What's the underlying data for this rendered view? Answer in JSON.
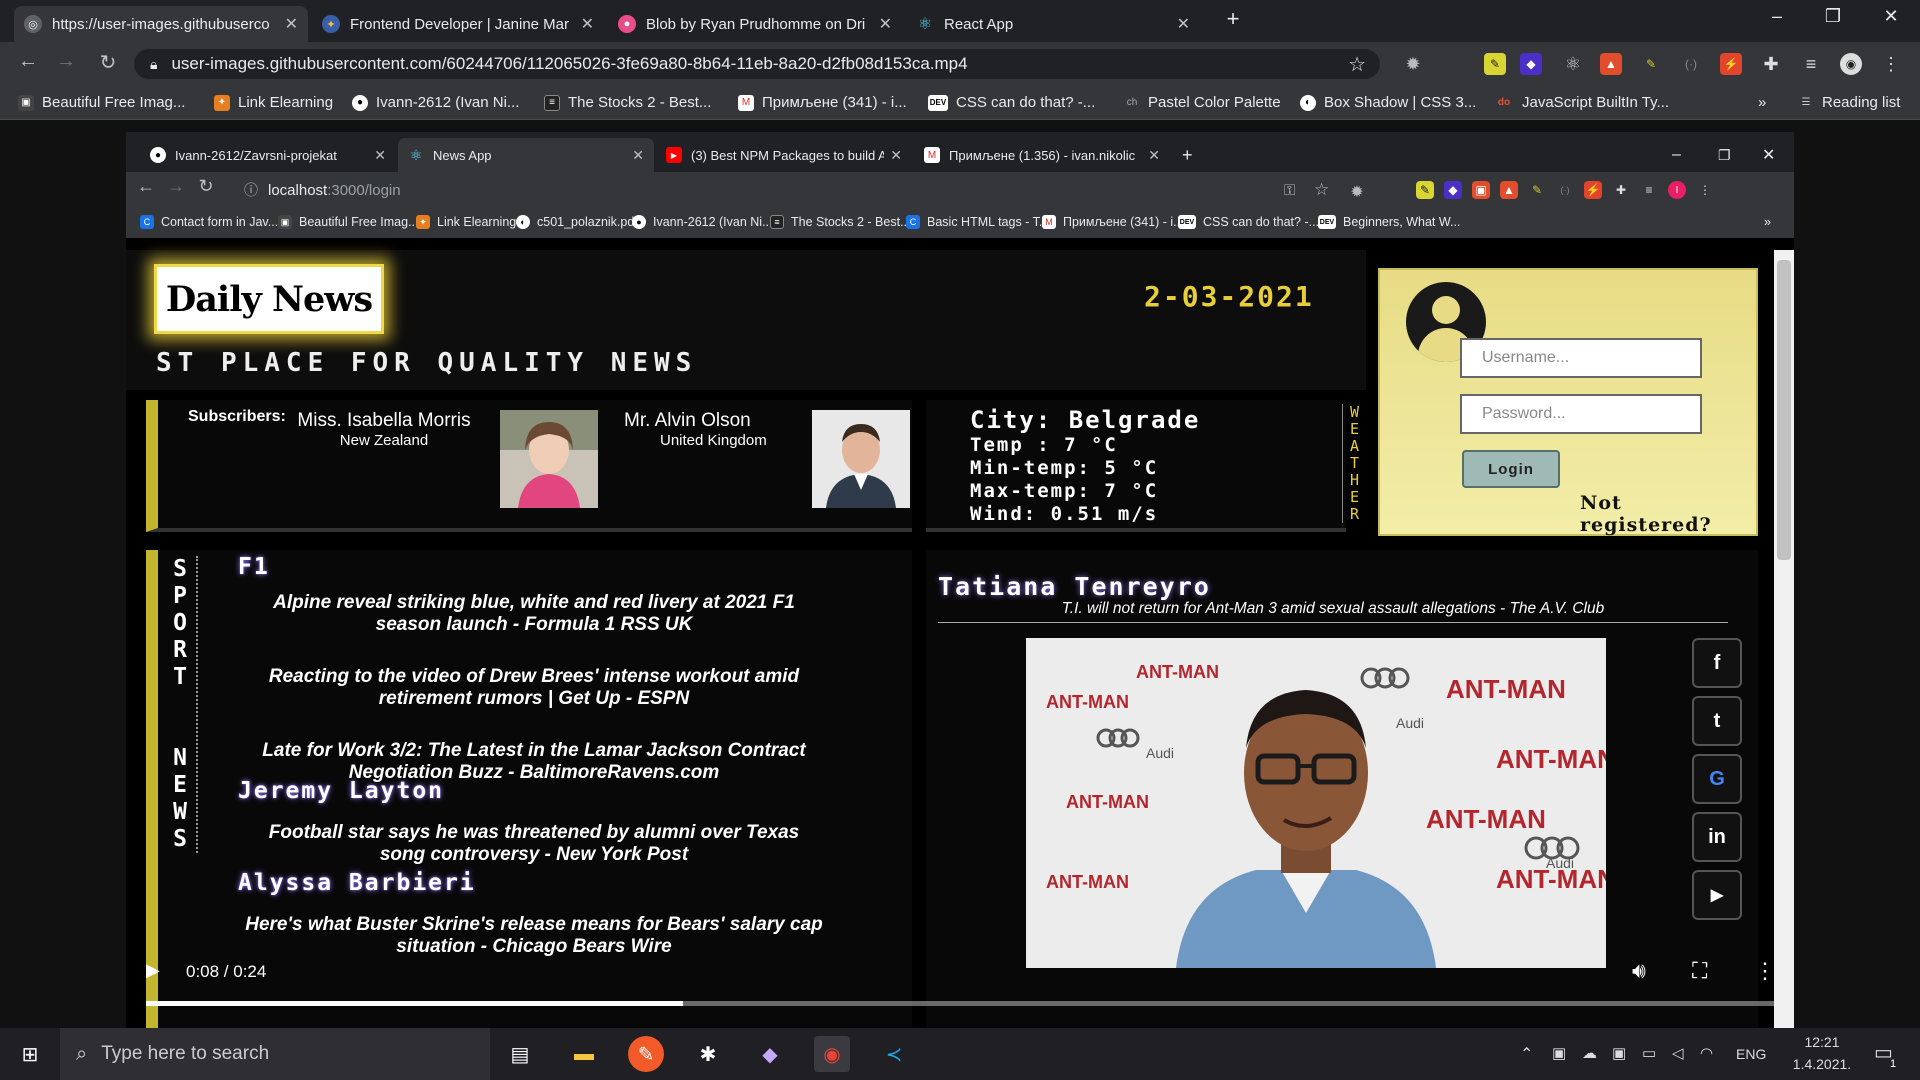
{
  "outer_browser": {
    "tabs": [
      {
        "title": "https://user-images.githubuserco",
        "active": true
      },
      {
        "title": "Frontend Developer | Janine Mar",
        "active": false
      },
      {
        "title": "Blob by Ryan Prudhomme on Dri",
        "active": false
      },
      {
        "title": "React App",
        "active": false
      }
    ],
    "new_tab": "+",
    "url": "user-images.githubusercontent.com/60244706/112065026-3fe69a80-8b64-11eb-8a20-d2fb08d153ca.mp4",
    "bookmarks": [
      "Beautiful Free Imag...",
      "Link Elearning",
      "Ivann-2612 (Ivan Ni...",
      "The Stocks 2 - Best...",
      "Примљене (341) - i...",
      "CSS can do that? -...",
      "Pastel Color Palette",
      "Box Shadow | CSS 3...",
      "JavaScript BuiltIn Ty..."
    ],
    "bookmarks_overflow": "»",
    "reading_list": "Reading list"
  },
  "inner_browser": {
    "tabs": [
      {
        "title": "Ivann-2612/Zavrsni-projekat",
        "active": false
      },
      {
        "title": "News App",
        "active": true
      },
      {
        "title": "(3) Best NPM Packages to build A",
        "active": false
      },
      {
        "title": "Примљене (1.356) - ivan.nikolic",
        "active": false
      }
    ],
    "url_host": "localhost",
    "url_path": ":3000/login",
    "bookmarks": [
      "Contact form in Jav...",
      "Beautiful Free Imag...",
      "Link Elearning",
      "c501_polaznik.pdf",
      "Ivann-2612 (Ivan Ni...",
      "The Stocks 2 - Best...",
      "Basic HTML tags - T...",
      "Примљене (341) - i...",
      "CSS can do that? -...",
      "Beginners, What W..."
    ]
  },
  "site": {
    "logo": "Daily News",
    "tagline": "ST PLACE FOR QUALITY NEWS",
    "date": "2-03-2021",
    "login": {
      "username_placeholder": "Username...",
      "password_placeholder": "Password...",
      "button": "Login",
      "not_registered": "Not registered?"
    },
    "subscribers": {
      "label": "Subscribers:",
      "people": [
        {
          "name": "Miss. Isabella Morris",
          "country": "New Zealand"
        },
        {
          "name": "Mr. Alvin Olson",
          "country": "United Kingdom"
        }
      ]
    },
    "weather": {
      "city": "City: Belgrade",
      "temp": "Temp : 7 °C",
      "min": "Min-temp: 5 °C",
      "max": "Max-temp: 7 °C",
      "wind": "Wind: 0.51 m/s",
      "vertical": "WEATHER"
    },
    "sport": {
      "vertical": "SPORT NEWS",
      "groups": [
        {
          "author": "F1",
          "articles": [
            "Alpine reveal striking blue, white and red livery at 2021 F1 season launch - Formula 1 RSS UK",
            "Reacting to the video of Drew Brees' intense workout amid retirement rumors | Get Up - ESPN",
            "Late for Work 3/2: The Latest in the Lamar Jackson Contract Negotiation Buzz - BaltimoreRavens.com"
          ]
        },
        {
          "author": "Jeremy Layton",
          "articles": [
            "Football star says he was threatened by alumni over Texas song controversy - New York Post"
          ]
        },
        {
          "author": "Alyssa Barbieri",
          "articles": [
            "Here's what Buster Skrine's release means for Bears' salary cap situation - Chicago Bears Wire"
          ]
        }
      ]
    },
    "feature": {
      "author": "Tatiana Tenreyro",
      "headline": "T.I. will not return for Ant-Man 3 amid sexual assault allegations - The A.V. Club",
      "backdrop_words": [
        "ANT-MAN",
        "Audi"
      ],
      "social": [
        "facebook-icon",
        "twitter-icon",
        "google-icon",
        "linkedin-icon",
        "youtube-icon"
      ]
    }
  },
  "video": {
    "time": "0:08 / 0:24",
    "progress": 0.33
  },
  "taskbar": {
    "search_placeholder": "Type here to search",
    "lang": "ENG",
    "time": "12:21",
    "date": "1.4.2021.",
    "notifications": "1"
  },
  "colors": {
    "accent_yellow": "#e8cf3a",
    "login_bg": "#e7dc85",
    "glow_purple": "#8a6fe6"
  }
}
